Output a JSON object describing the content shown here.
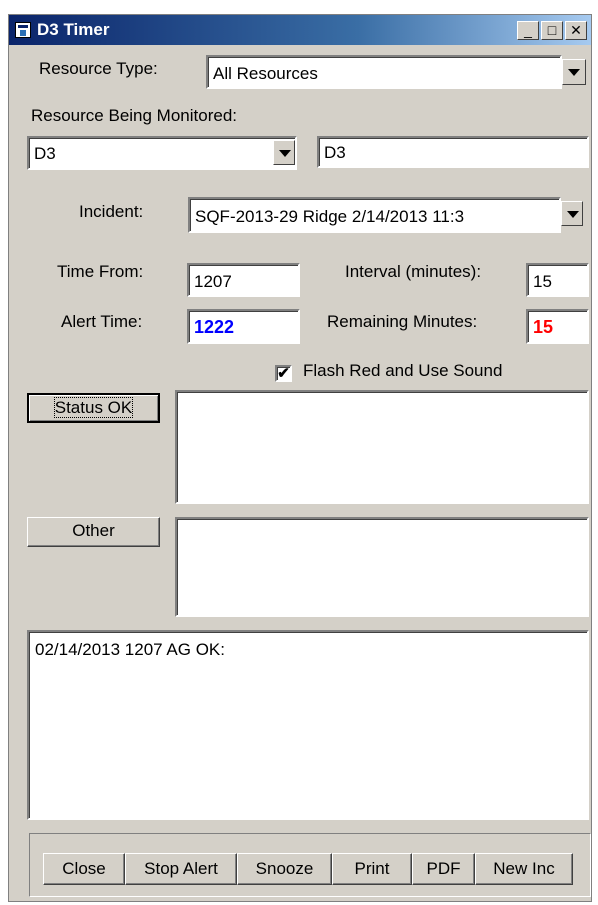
{
  "window": {
    "title": "D3 Timer",
    "minimize_label": "_",
    "maximize_label": "□",
    "close_label": "✕"
  },
  "resource_type": {
    "label": "Resource Type:",
    "value": "All Resources"
  },
  "resource_monitored": {
    "label": "Resource Being Monitored:",
    "combo_value": "D3",
    "text_value": "D3"
  },
  "incident": {
    "label": "Incident:",
    "value": "SQF-2013-29   Ridge 2/14/2013 11:3"
  },
  "time_from": {
    "label": "Time From:",
    "value": "1207"
  },
  "interval": {
    "label": "Interval (minutes):",
    "value": "15"
  },
  "alert_time": {
    "label": "Alert Time:",
    "value": "1222",
    "color": "#0000ff"
  },
  "remaining": {
    "label": "Remaining Minutes:",
    "value": "15",
    "color": "#ff0000"
  },
  "flash": {
    "label": "Flash Red and Use Sound",
    "checked": true,
    "mark": "✔"
  },
  "status_ok": {
    "label": "Status OK"
  },
  "other": {
    "label": "Other"
  },
  "log": {
    "text": "02/14/2013 1207 AG OK:"
  },
  "buttons": {
    "close": "Close",
    "stop_alert": "Stop Alert",
    "snooze": "Snooze",
    "print": "Print",
    "pdf": "PDF",
    "new_inc": "New Inc"
  }
}
